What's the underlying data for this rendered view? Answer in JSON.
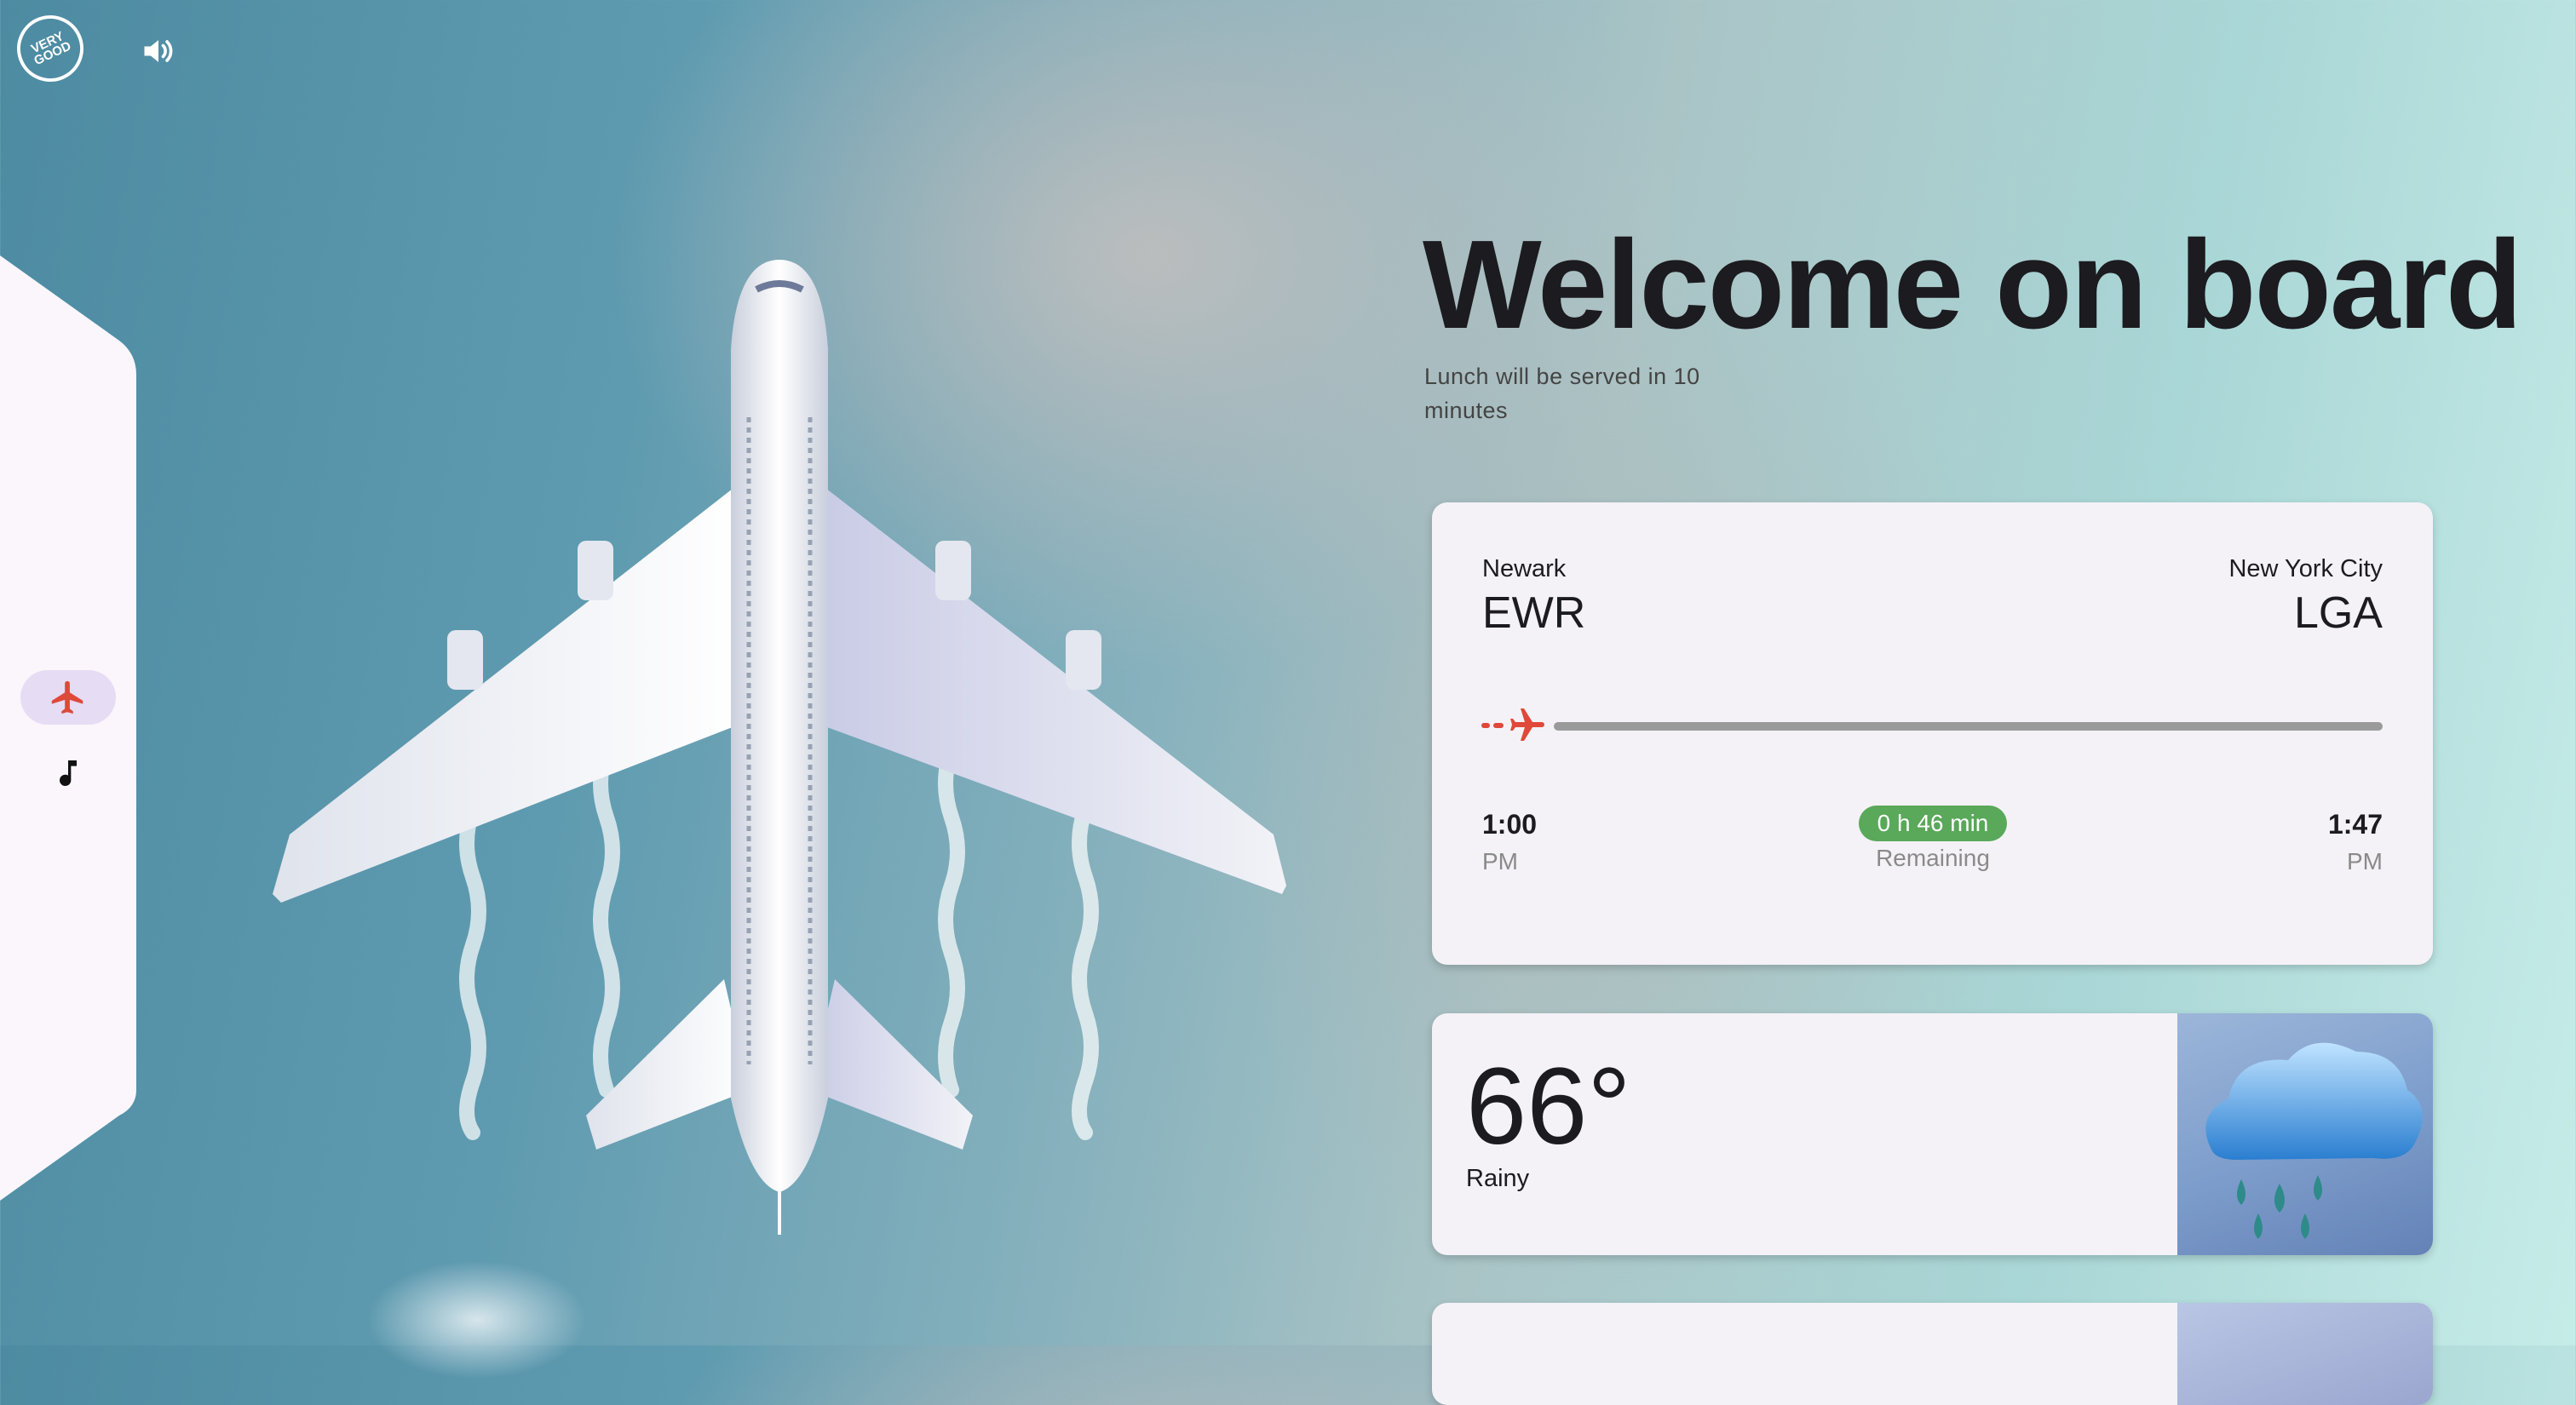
{
  "app": {
    "logo_text": "VERY GOOD"
  },
  "header": {
    "title": "Welcome on board",
    "subtitle": "Lunch will be served in 10 minutes"
  },
  "nav": {
    "items": [
      {
        "icon": "airplane-icon",
        "selected": true
      },
      {
        "icon": "music-note-icon",
        "selected": false
      }
    ]
  },
  "flight": {
    "origin_city": "Newark",
    "origin_code": "EWR",
    "destination_city": "New York City",
    "destination_code": "LGA",
    "departure_time": "1:00",
    "departure_ampm": "PM",
    "arrival_time": "1:47",
    "arrival_ampm": "PM",
    "remaining_duration": "0 h 46 min",
    "remaining_label": "Remaining",
    "progress": 0.0
  },
  "weather": {
    "temperature": "66°",
    "condition": "Rainy",
    "icon": "rain-cloud-icon"
  },
  "colors": {
    "accent": "#e0483a",
    "pill": "#5aa85a",
    "nav_selected": "#e6dcf3"
  }
}
